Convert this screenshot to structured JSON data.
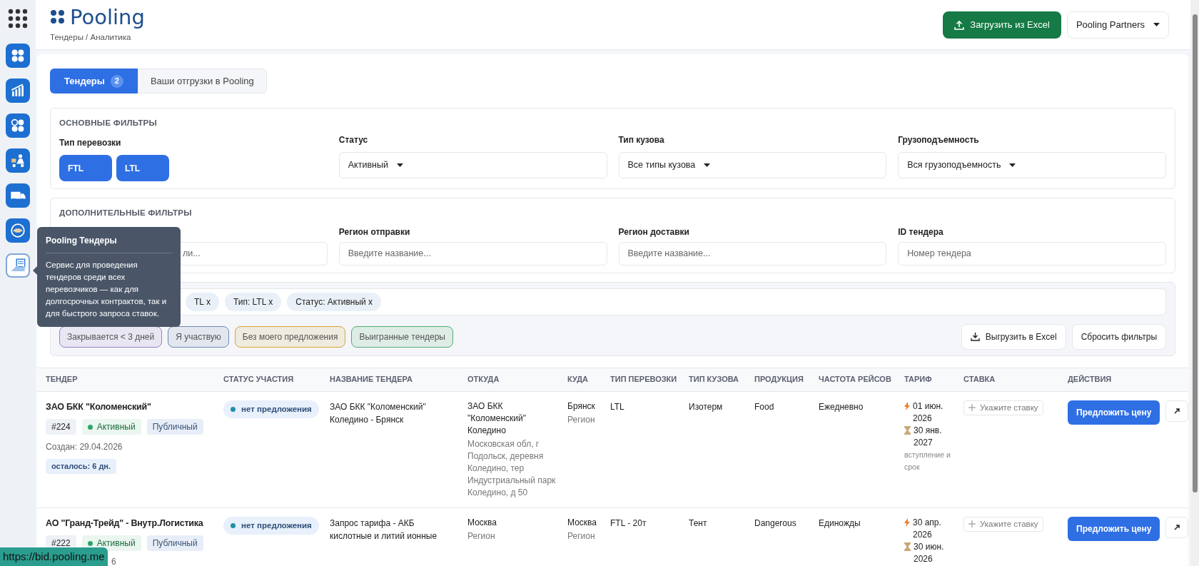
{
  "logo": {
    "text": "Pooling"
  },
  "breadcrumb": "Тендеры / Аналитика",
  "header_actions": {
    "upload_button": "Загрузить из Excel",
    "company_dropdown": "Pooling Partners"
  },
  "sidebar": {
    "apps": [
      {
        "selected": false
      },
      {
        "selected": false
      },
      {
        "selected": false
      },
      {
        "selected": false
      },
      {
        "selected": false
      },
      {
        "selected": false
      },
      {
        "selected": true
      }
    ]
  },
  "tooltip": {
    "title": "Pooling Тендеры",
    "text": "Сервис для проведения тендеров среди всех перевозчиков — как для долгосрочных контрактов, так и для быстрого запроса ставок."
  },
  "tabs": [
    {
      "label": "Тендеры",
      "count": "2",
      "selected": true
    },
    {
      "label": "Ваши отгрузки в Pooling",
      "selected": false
    }
  ],
  "main_filters": {
    "title": "ОСНОВНЫЕ ФИЛЬТРЫ",
    "transport_type": {
      "label": "Тип перевозки",
      "options": [
        {
          "label": "FTL",
          "selected": true
        },
        {
          "label": "LTL",
          "selected": true
        }
      ]
    },
    "selects": [
      {
        "label": "Статус",
        "value": "Активный"
      },
      {
        "label": "Тип кузова",
        "value": "Все типы кузова"
      },
      {
        "label": "Грузоподъемность",
        "value": "Вся грузоподъемность"
      }
    ]
  },
  "extra_filters": {
    "title": "ДОПОЛНИТЕЛЬНЫЕ ФИЛЬТРЫ",
    "fields": [
      {
        "placeholder": "ли..."
      },
      {
        "label": "Регион отправки",
        "placeholder": "Введите название..."
      },
      {
        "label": "Регион доставки",
        "placeholder": "Введите название..."
      },
      {
        "label": "ID тендера",
        "placeholder": "Номер тендера"
      }
    ]
  },
  "active_chips": [
    "TL x",
    "Тип: LTL x",
    "Статус: Активный x"
  ],
  "quick_filters": [
    {
      "label": "Закрывается < 3 дней",
      "color": "#9b7fc9"
    },
    {
      "label": "Я участвую",
      "color": "#6f86b3"
    },
    {
      "label": "Без моего предложения",
      "color": "#d6a53a"
    },
    {
      "label": "Выигранные тендеры",
      "color": "#4fae73"
    }
  ],
  "filter_actions": {
    "export_button": "Выгрузить в Excel",
    "reset_button": "Сбросить фильтры"
  },
  "table": {
    "columns": [
      "ТЕНДЕР",
      "СТАТУС УЧАСТИЯ",
      "НАЗВАНИЕ ТЕНДЕРА",
      "ОТКУДА",
      "КУДА",
      "ТИП ПЕРЕВОЗКИ",
      "ТИП КУЗОВА",
      "ПРОДУКЦИЯ",
      "ЧАСТОТА РЕЙСОВ",
      "ТАРИФ",
      "СТАВКА",
      "ДЕЙСТВИЯ"
    ],
    "rows": [
      {
        "company": "ЗАО БКК \"Коломенский\"",
        "number": "#224",
        "status": "Активный",
        "visibility": "Публичный",
        "created": "Создан: 29.04.2026",
        "created_covered": false,
        "remaining": "осталось: 6 дн.",
        "participation": "нет предложения",
        "name": "ЗАО БКК \"Коломенский\" Коледино - Брянск",
        "from": "ЗАО БКК \"Коломенский\" Коледино",
        "from_detail": "Московская обл, г Подольск, деревня Коледино, тер Индустриальный парк Коледино, д 50",
        "to": "Брянск",
        "to_detail": "Регион",
        "transport": "LTL",
        "body": "Изотерм",
        "product": "Food",
        "frequency": "Ежедневно",
        "tariff": [
          {
            "kind": "start",
            "text": "01 июн. 2026"
          },
          {
            "kind": "end",
            "text": "30 янв. 2027"
          }
        ],
        "tariff_note": "вступление и срок",
        "bid_placeholder": "Укажите ставку",
        "offer_button": "Предложить цену"
      },
      {
        "company": "АО \"Гранд-Трейд\" - Внутр.Логистика",
        "number": "#222",
        "status": "Активный",
        "visibility": "Публичный",
        "created": "6",
        "created_covered": true,
        "participation": "нет предложения",
        "name": "Запрос тарифа - АКБ кислотные и литий ионные",
        "from": "Москва",
        "from_detail": "Регион",
        "to": "Москва",
        "to_detail": "Регион",
        "transport": "FTL - 20т",
        "body": "Тент",
        "product": "Dangerous",
        "frequency": "Единожды",
        "tariff": [
          {
            "kind": "start",
            "text": "30 апр. 2026"
          },
          {
            "kind": "end",
            "text": "30 июн. 2026"
          }
        ],
        "bid_placeholder": "Укажите ставку",
        "offer_button": "Предложить цену"
      }
    ]
  },
  "status_url": "https://bid.pooling.me"
}
